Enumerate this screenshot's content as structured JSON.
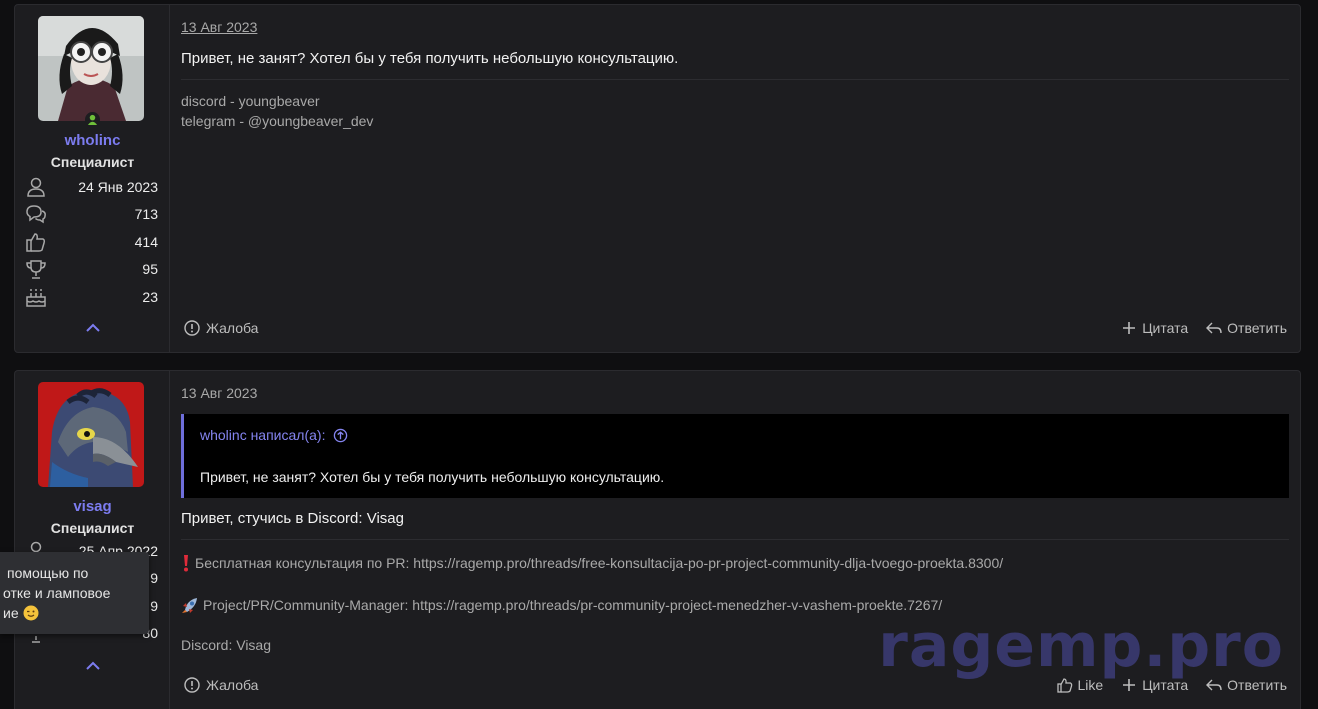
{
  "posts": [
    {
      "username": "wholinc",
      "user_title": "Специалист",
      "stats": [
        "24 Янв 2023",
        "713",
        "414",
        "95",
        "23"
      ],
      "date": "13 Авг 2023",
      "message": "Привет, не занят? Хотел бы у тебя получить небольшую консультацию.",
      "signature": [
        "discord - youngbeaver",
        "telegram - @youngbeaver_dev"
      ],
      "report": "Жалоба",
      "quote_action": "Цитата",
      "reply": "Ответить"
    },
    {
      "username": "visag",
      "user_title": "Специалист",
      "stats": [
        "25 Апр 2022",
        "9",
        "9",
        "80"
      ],
      "date": "13 Авг 2023",
      "quote_author": "wholinc написал(а):",
      "quote_text": "Привет, не занят? Хотел бы у тебя получить небольшую консультацию.",
      "message": "Привет, стучись в Discord: Visag",
      "signature": [
        "Бесплатная консультация по PR: https://ragemp.pro/threads/free-konsultacija-po-pr-project-community-dlja-tvoego-proekta.8300/",
        "Project/PR/Community-Manager: https://ragemp.pro/threads/pr-community-project-menedzher-v-vashem-proekte.7267/",
        "Discord: Visag"
      ],
      "report": "Жалоба",
      "like": "Like",
      "quote_action": "Цитата",
      "reply": "Ответить"
    }
  ],
  "tooltip": [
    "помощью по",
    "отке и ламповое",
    "ие"
  ],
  "watermark": "ragemp.pro",
  "colors": {
    "accent": "#7c7cf0",
    "online": "#6fbf3a",
    "alert": "#e02b3a"
  }
}
